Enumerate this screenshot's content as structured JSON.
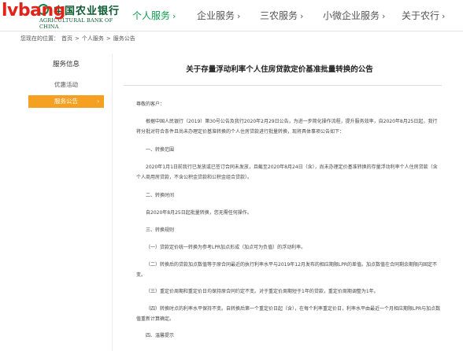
{
  "brand": {
    "watermark": "lvbang",
    "name_cn": "中国农业银行",
    "name_en": "AGRICULTURAL BANK OF CHINA"
  },
  "nav": [
    {
      "label": "个人服务",
      "arrow": "›",
      "active": true
    },
    {
      "label": "企业服务",
      "arrow": "›",
      "active": false
    },
    {
      "label": "三农服务",
      "arrow": "›",
      "active": false
    },
    {
      "label": "小微企业服务",
      "arrow": "›",
      "active": false
    },
    {
      "label": "关于农行",
      "arrow": "›",
      "active": false
    }
  ],
  "breadcrumb": {
    "prefix": "您现在的位置：",
    "items": [
      "首页",
      "个人服务",
      "服务公告"
    ],
    "sep": ">"
  },
  "sidebar": {
    "title": "服务信息",
    "items": [
      {
        "label": "优惠活动",
        "active": false
      },
      {
        "label": "服务公告",
        "active": true,
        "chevron": "›"
      }
    ]
  },
  "article": {
    "title": "关于存量浮动利率个人住房贷款定价基准批量转换的公告",
    "greeting": "尊敬的客户：",
    "p1": "根据中国人民银行（2019）第30号公告及我行2020年2月29日公告，为进一步简化操作流程，提升服务效率，自2020年8月25日起，我行将分批对符合条件且尚未办理定价基准转换的个人住房贷款进行批量转换，现将具体事项公告如下：",
    "h1": "一、转换范围",
    "p2": "2020年1月1日前我行已发放或已签订合同未发放，且截至2020年8月24日（含），尚未办理定价基准转换的存量浮动利率个人住房贷款（含个人商用房贷款，不含公积金贷款和公积金组合贷款）。",
    "h2": "二、转换时间",
    "p3": "自2020年8月25日起批量转换，您无需任何操作。",
    "h3": "三、转换规则",
    "p4": "（一）贷款定价统一转换为参考LPR加点形成（加点可为负值）的浮动利率。",
    "p5": "（二）转换后的贷款加点数值等于原合同最近的执行利率水平与2019年12月发布的相应期限LPR的差值。加点数值在合同剩余期限内固定不变。",
    "p6": "（三）重定价周期和重定价日均保持原合同约定不变。对于重定价周期短于1年的贷款，重定价周期调整为1年。",
    "p7": "（四）转换时点的利率水平保持不变。自转换后第一个重定价日起（含），在每个利率重定价日，利率水平由最近一个月相应期限LPR与加点数值重新计算确定。",
    "h4": "四、温馨提示"
  }
}
